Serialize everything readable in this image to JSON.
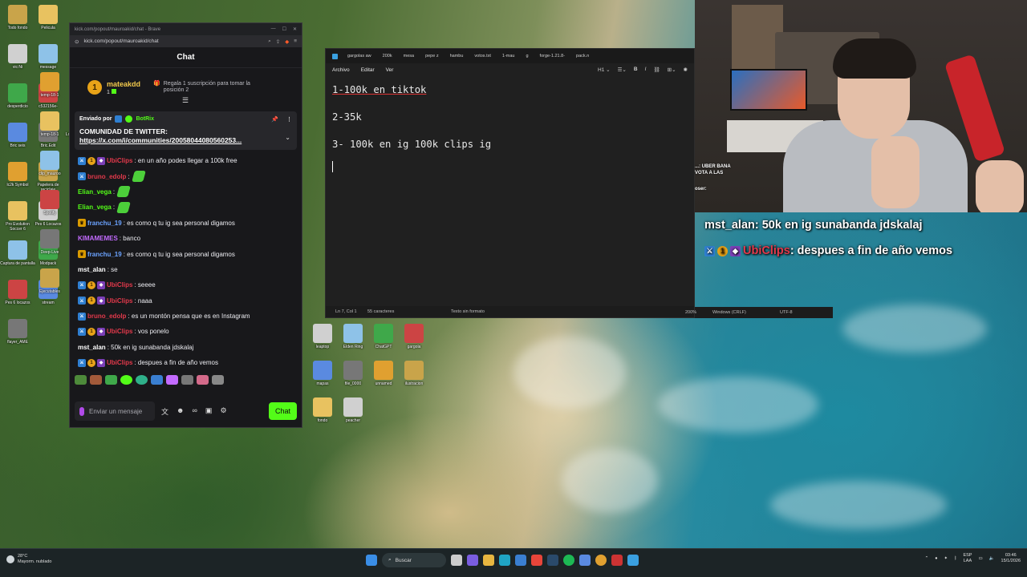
{
  "browser": {
    "title": "kick.com/popout/mauroakid/chat - Brave",
    "url": "kick.com/popout/mauroakid/chat",
    "chat_title": "Chat",
    "sub_promo": {
      "username": "mateakdd",
      "count": "1",
      "badge_number": "1",
      "text": "Regala 1 suscripción para tomar la posición 2"
    },
    "pinned": {
      "sent_by": "Enviado por",
      "bot_name": "BotRix",
      "title": "COMUNIDAD DE TWITTER:",
      "link": "https://x.com/i/communities/20058044080560253..."
    },
    "messages": [
      {
        "user": "UbiClips",
        "color": "#e2394b",
        "badges": [
          "blue",
          "gold",
          "purple"
        ],
        "text": ": en un año podes llegar a 100k free"
      },
      {
        "user": "bruno_edolp",
        "color": "#e2394b",
        "badges": [
          "blue"
        ],
        "text": ":",
        "emote": true
      },
      {
        "user": "Elian_vega",
        "color": "#53fc18",
        "badges": [],
        "text": ":",
        "emote": true
      },
      {
        "user": "Elian_vega",
        "color": "#53fc18",
        "badges": [],
        "text": ":",
        "emote": true
      },
      {
        "user": "franchu_19",
        "color": "#6ba3ff",
        "badges": [
          "crown"
        ],
        "text": ": es como q tu ig sea personal digamos"
      },
      {
        "user": "KIMAMEMES",
        "color": "#c36bff",
        "badges": [],
        "text": ": banco"
      },
      {
        "user": "franchu_19",
        "color": "#6ba3ff",
        "badges": [
          "crown"
        ],
        "text": ": es como q tu ig sea personal digamos"
      },
      {
        "user": "mst_alan",
        "color": "#ffffff",
        "badges": [],
        "text": ": se"
      },
      {
        "user": "UbiClips",
        "color": "#e2394b",
        "badges": [
          "blue",
          "gold",
          "purple"
        ],
        "text": ": seeee"
      },
      {
        "user": "UbiClips",
        "color": "#e2394b",
        "badges": [
          "blue",
          "gold",
          "purple"
        ],
        "text": ": naaa"
      },
      {
        "user": "bruno_edolp",
        "color": "#e2394b",
        "badges": [
          "blue"
        ],
        "text": ": es un montón pensa que es en Instagram"
      },
      {
        "user": "UbiClips",
        "color": "#e2394b",
        "badges": [
          "blue",
          "gold",
          "purple"
        ],
        "text": ": vos ponelo"
      },
      {
        "user": "mst_alan",
        "color": "#ffffff",
        "badges": [],
        "text": ": 50k en ig sunabanda jdskalaj"
      },
      {
        "user": "UbiClips",
        "color": "#e2394b",
        "badges": [
          "blue",
          "gold",
          "purple"
        ],
        "text": ": despues a fin de año vemos"
      }
    ],
    "input_placeholder": "Enviar un mensaje",
    "send_label": "Chat"
  },
  "notepad": {
    "tabs": [
      "gargolas aw",
      "200k",
      "mesa",
      "pepe z",
      "hambu",
      "votos.txt",
      "1-mau",
      "g",
      "forge-1.21.8-",
      "pack.n"
    ],
    "menu": [
      "Archivo",
      "Editar",
      "Ver"
    ],
    "heading_select": "H1",
    "lines": [
      "1-100k en tiktok",
      "2-35k",
      "3- 100k en ig  100k clips ig"
    ],
    "status": {
      "position": "Ln 7, Col 1",
      "chars": "55 caracteres",
      "format": "Texto sin formato",
      "zoom": "200%",
      "eol": "Windows (CRLF)",
      "encoding": "UTF-8"
    }
  },
  "overlay": {
    "messages": [
      {
        "user": "mst_alan",
        "color": "#ffffff",
        "text": ": 50k en ig sunabanda jdskalaj",
        "badges": []
      },
      {
        "user": "UbiClips",
        "color": "#e2394b",
        "text": ": despues a fin de año vemos",
        "badges": [
          "blue",
          "gold",
          "purple"
        ]
      }
    ]
  },
  "webcam": {
    "mini_chat": [
      "...: UBER BANA",
      "VOTA A LAS",
      "oser:"
    ]
  },
  "desktop_icons": [
    "Todo fondo",
    "Pelicula",
    "vic:Ni",
    "message",
    "desperdicio",
    "c532156e-",
    "Bric seis",
    "Bric.Edit",
    "lc2k Symbol",
    "Papelera de reciclaje",
    "Pro Evolution Soccer 6",
    "Pes 6 Locazos",
    "Captura de pantalla",
    "Modpack",
    "Pes 6 locazos",
    "stream",
    "flayer_AME",
    "temp-18-1",
    "tema-18-1",
    "temp-18-1",
    "Logitech G HUB",
    "clip_mauroo",
    "Fortnite",
    "Spotify",
    "BlueStacks",
    "Deep-Live",
    "Tu pasa",
    "Ejecutables",
    "black back",
    "leaptop",
    "Elden Ring",
    "ChatGPT",
    "gargola",
    "mapas",
    "file_0000",
    "unnamed",
    "ilustracion",
    "fondo",
    "peacher"
  ],
  "taskbar": {
    "weather_temp": "28°C",
    "weather_desc": "Mayorm. nublado",
    "search_placeholder": "Buscar",
    "lang_line1": "ESP",
    "lang_line2": "LAA",
    "time": "03:46",
    "date": "15/1/2026"
  },
  "colors": {
    "kick_green": "#53fc18",
    "chat_bg": "#18181b",
    "notepad_bg": "#202020"
  }
}
